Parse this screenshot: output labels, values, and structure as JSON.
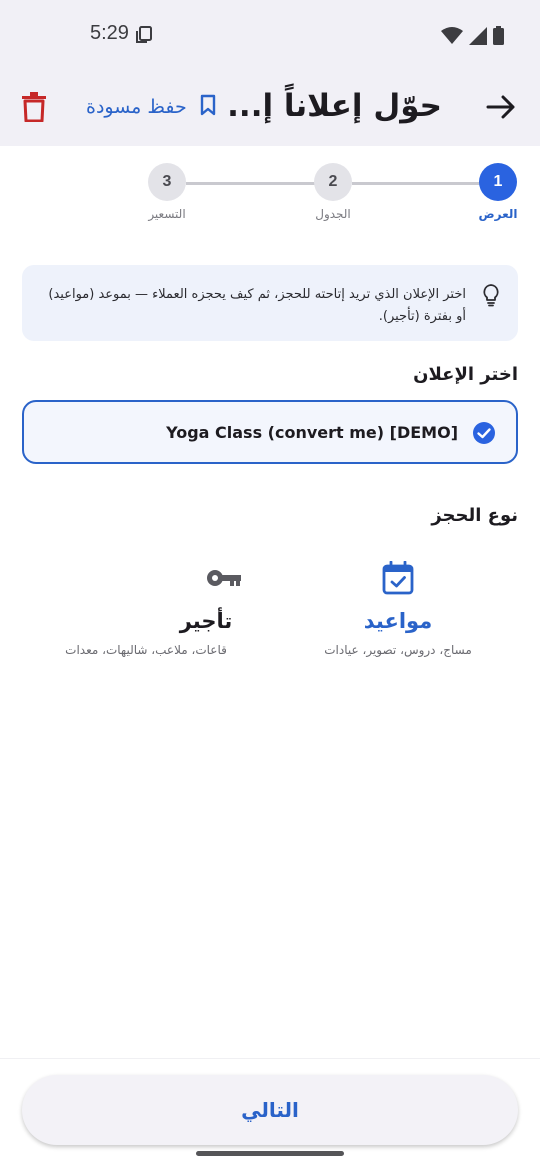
{
  "status_bar": {
    "time": "5:29",
    "icons": [
      "copy-notification-icon",
      "wifi-icon",
      "signal-icon",
      "battery-icon"
    ]
  },
  "app_bar": {
    "title": "حوّل إعلاناً إ...",
    "save_draft_label": "حفظ مسودة",
    "icons": [
      "back-arrow-icon",
      "bookmark-icon",
      "trash-icon"
    ]
  },
  "stepper": {
    "steps": [
      {
        "number": "1",
        "label": "العرض",
        "active": true
      },
      {
        "number": "2",
        "label": "الجدول",
        "active": false
      },
      {
        "number": "3",
        "label": "التسعير",
        "active": false
      }
    ]
  },
  "hint": {
    "icon": "lightbulb-icon",
    "text": "اختر الإعلان الذي تريد إتاحته للحجز، ثم كيف يحجزه العملاء — بموعد (مواعيد) أو بفترة (تأجير)."
  },
  "listing_section": {
    "title": "اختر الإعلان",
    "selected_listing": "Yoga Class (convert me) [DEMO]"
  },
  "booking_type_section": {
    "title": "نوع الحجز",
    "options": [
      {
        "title": "مواعيد",
        "description": "مساج، دروس، تصوير، عيادات",
        "icon": "calendar-check-icon",
        "selected": true
      },
      {
        "title": "تأجير",
        "description": "قاعات، ملاعب، شاليهات، معدات",
        "icon": "key-icon",
        "selected": false
      }
    ]
  },
  "footer": {
    "next_label": "التالي"
  },
  "colors": {
    "accent": "#2a63c9",
    "active_step": "#2a63e0",
    "delete": "#c62828",
    "app_bar_bg": "#f1f0f6",
    "hint_bg": "#eef2fb"
  }
}
